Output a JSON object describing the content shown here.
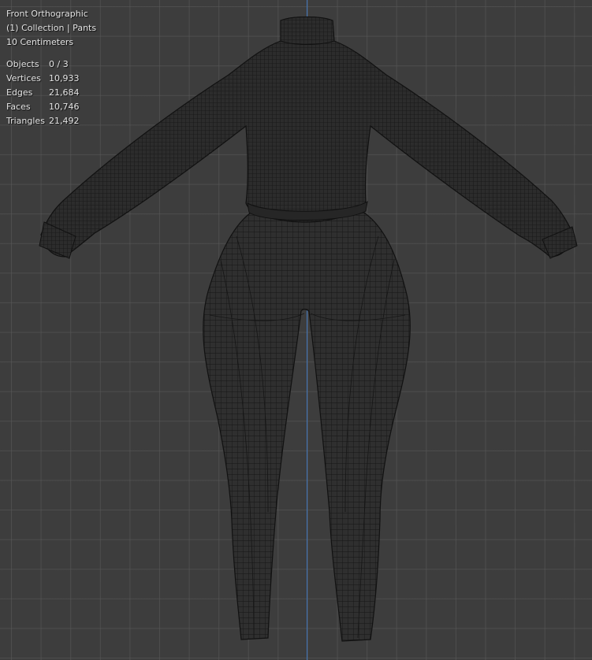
{
  "viewport": {
    "view_name": "Front Orthographic",
    "collection_info": "(1) Collection | Pants",
    "grid_scale": "10 Centimeters"
  },
  "stats": [
    {
      "label": "Objects",
      "value": "0 / 3"
    },
    {
      "label": "Vertices",
      "value": "10,933"
    },
    {
      "label": "Edges",
      "value": "21,684"
    },
    {
      "label": "Faces",
      "value": "10,746"
    },
    {
      "label": "Triangles",
      "value": "21,492"
    }
  ],
  "colors": {
    "background": "#3d3d3d",
    "grid": "#5a5a5a",
    "axis": "#3f74b8",
    "mesh_fill": "#2e2e2e",
    "wire": "#111111"
  }
}
